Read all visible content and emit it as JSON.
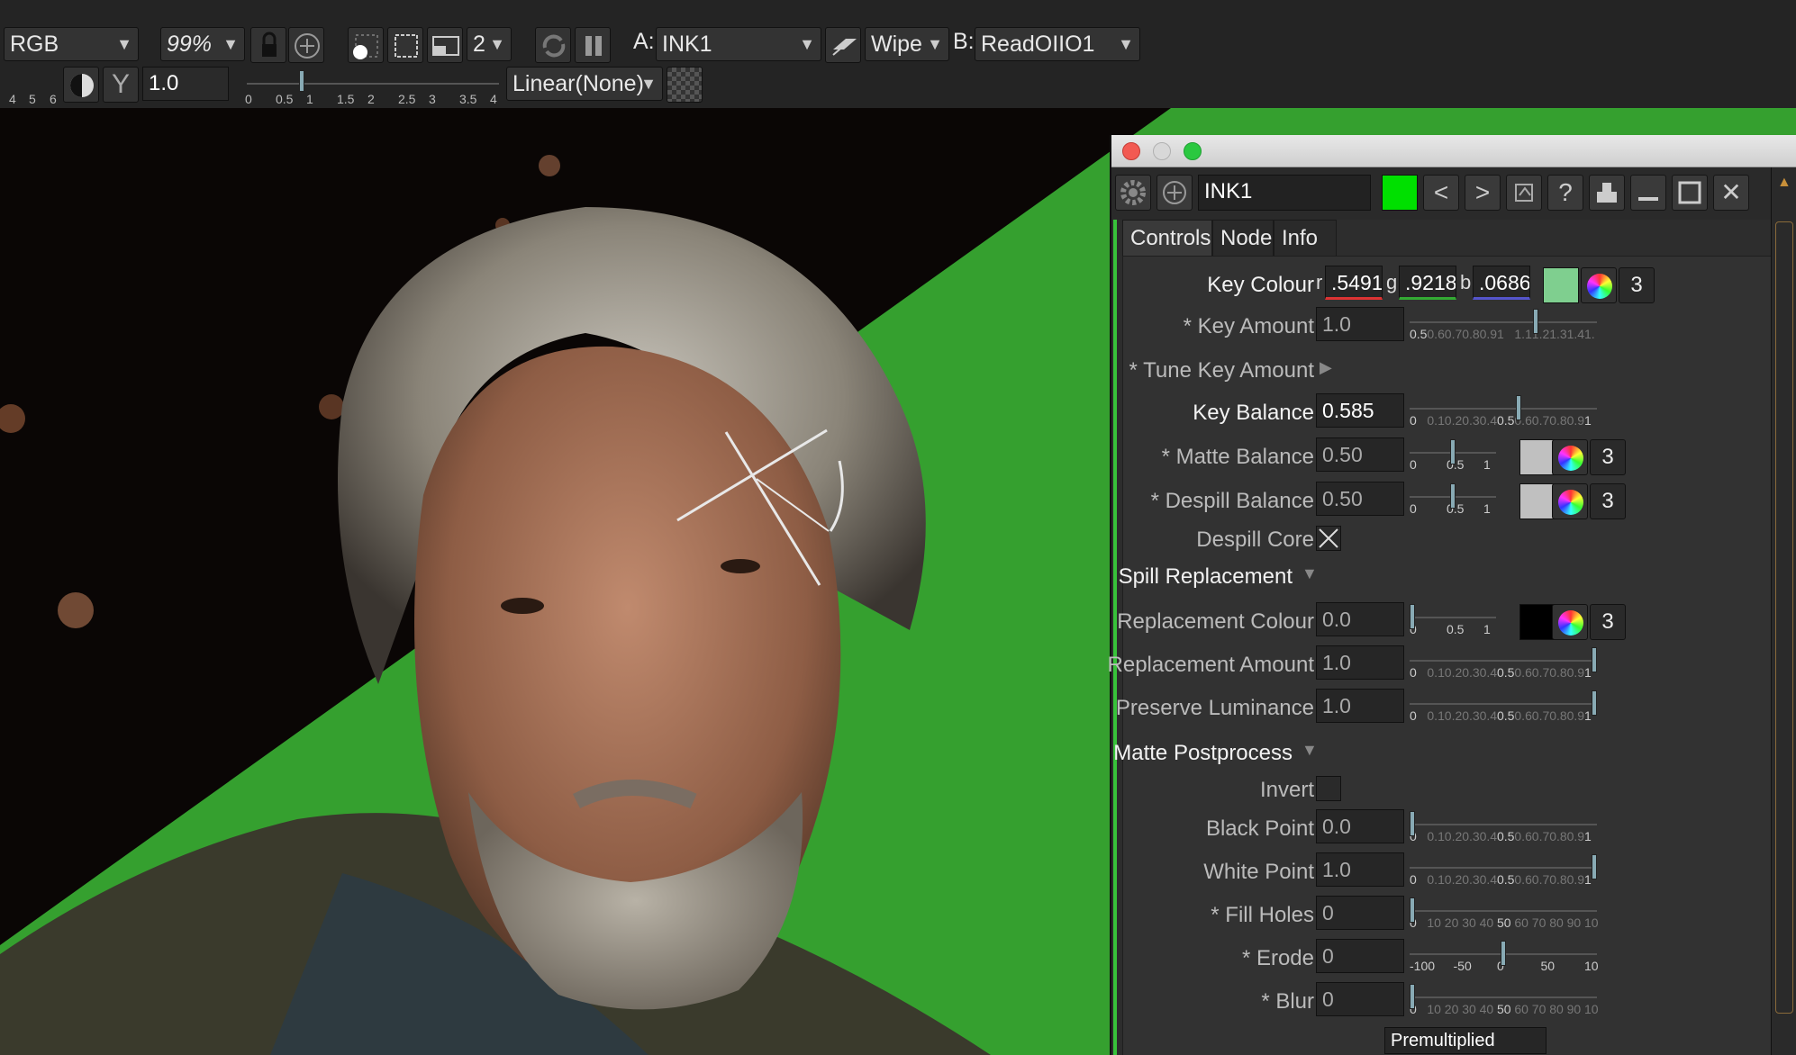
{
  "toolbar": {
    "channels": "RGB",
    "zoom": "99%",
    "proxy": "2",
    "input_a_label": "A:",
    "input_a": "INK1",
    "compare": "Wipe",
    "input_b_label": "B:",
    "input_b": "ReadOIIO1",
    "gamma": "1.0",
    "lut": "Linear(None)",
    "left_ticks": [
      "4",
      "5",
      "6"
    ],
    "gain_ticks": [
      "0",
      "0.5",
      "1",
      "1.5",
      "2",
      "2.5",
      "3",
      "3.5",
      "4"
    ]
  },
  "panel": {
    "node_name": "INK1",
    "node_color": "#00e000",
    "tabs": [
      "Controls",
      "Node",
      "Info"
    ],
    "key_colour": {
      "label": "Key Colour",
      "r_prefix": "r",
      "r": ".5491",
      "g_prefix": "g",
      "g": ".9218",
      "b_prefix": "b",
      "b": ".0686",
      "swatch": "#7fcf8f",
      "channels": "3"
    },
    "rows": [
      {
        "label": "* Key Amount",
        "value": "1.0",
        "type": "slider"
      },
      {
        "label": "* Tune Key Amount",
        "type": "disclosure"
      },
      {
        "label": "Key Balance",
        "value": "0.585",
        "type": "slider"
      },
      {
        "label": "* Matte Balance",
        "value": "0.50",
        "type": "slider-color",
        "channels": "3"
      },
      {
        "label": "* Despill Balance",
        "value": "0.50",
        "type": "slider-color",
        "channels": "3"
      },
      {
        "label": "Despill Core",
        "type": "checkbox",
        "checked": true
      },
      {
        "label": "Spill Replacement",
        "type": "section"
      },
      {
        "label": "Replacement Colour",
        "value": "0.0",
        "type": "slider-color",
        "channels": "3"
      },
      {
        "label": "Replacement Amount",
        "value": "1.0",
        "type": "slider"
      },
      {
        "label": "Preserve Luminance",
        "value": "1.0",
        "type": "slider"
      },
      {
        "label": "Matte Postprocess",
        "type": "section"
      },
      {
        "label": "Invert",
        "type": "checkbox",
        "checked": false
      },
      {
        "label": "Black Point",
        "value": "0.0",
        "type": "slider"
      },
      {
        "label": "White Point",
        "value": "1.0",
        "type": "slider"
      },
      {
        "label": "* Fill Holes",
        "value": "0",
        "type": "slider"
      },
      {
        "label": "* Erode",
        "value": "0",
        "type": "slider"
      },
      {
        "label": "* Blur",
        "value": "0",
        "type": "slider"
      }
    ],
    "output_mode_partial": "Premultiplied"
  },
  "slider_numbers": {
    "key_amount": [
      "0.5",
      "0.6",
      "0.7",
      "0.8",
      "0.9",
      "1",
      "1.1",
      "1.2",
      "1.3",
      "1.4",
      "1."
    ],
    "unit": [
      "0",
      "0.1",
      "0.2",
      "0.3",
      "0.4",
      "0.5",
      "0.6",
      "0.7",
      "0.8",
      "0.9",
      "1"
    ],
    "small": [
      "0",
      "0.5",
      "1"
    ],
    "fill": [
      "0",
      "10",
      "20",
      "30",
      "40",
      "50",
      "60",
      "70",
      "80",
      "90",
      "10"
    ],
    "erode": [
      "-100",
      "-50",
      "0",
      "50",
      "10"
    ]
  },
  "colors": {
    "green_screen": "#35a02f",
    "ui_bg": "#242424"
  }
}
